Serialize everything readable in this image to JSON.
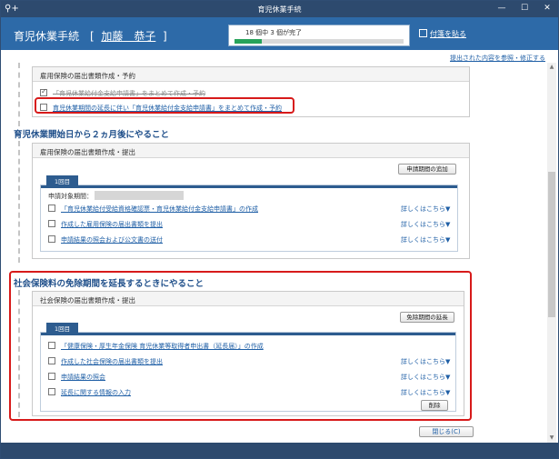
{
  "window": {
    "title": "育児休業手続",
    "app_icon": "⚲+"
  },
  "header": {
    "title": "育児休業手続",
    "name_open": "[",
    "name": "加藤　恭子",
    "name_close": "]",
    "progress_text": "18 個中 3 個が完了",
    "progress_fraction": 0.16,
    "sticky_label": "付箋を貼る"
  },
  "top_link": "提出された内容を参照・修正する",
  "section0": {
    "card_title": "雇用保険の届出書類作成・予約",
    "row1": "「育児休業給付金支給申請書」をまとめて作成・予約",
    "row2": "育児休業期間の延長に伴い「育児休業給付金支給申請書」をまとめて作成・予約"
  },
  "section1": {
    "title": "育児休業開始日から２ヵ月後にやること",
    "card_title": "雇用保険の届出書類作成・提出",
    "add_button": "申請期間の追加",
    "tab": "1回目",
    "period_label": "申請対象期間：",
    "items": [
      "「育児休業給付受給資格確認票・育児休業給付金支給申請書」の作成",
      "作成した雇用保険の届出書類を提出",
      "申請結果の照会および公文書の送付"
    ],
    "more": "詳しくはこちら▼"
  },
  "section2": {
    "title": "社会保険料の免除期間を延長するときにやること",
    "card_title": "社会保険の届出書類作成・提出",
    "extend_button": "免除期間の延長",
    "tab": "1回目",
    "items": [
      "「健康保険・厚生年金保険 育児休業等取得者申出書（延長届）」の作成",
      "作成した社会保険の届出書類を提出",
      "申請結果の照会",
      "延長に関する情報の入力"
    ],
    "more": "詳しくはこちら▼",
    "delete_button": "削除"
  },
  "close_button": "閉じる(C)",
  "colors": {
    "header": "#2d6aa8",
    "titlebar": "#2d4a6e",
    "highlight": "#d71a1a",
    "progress": "#27a35b"
  }
}
